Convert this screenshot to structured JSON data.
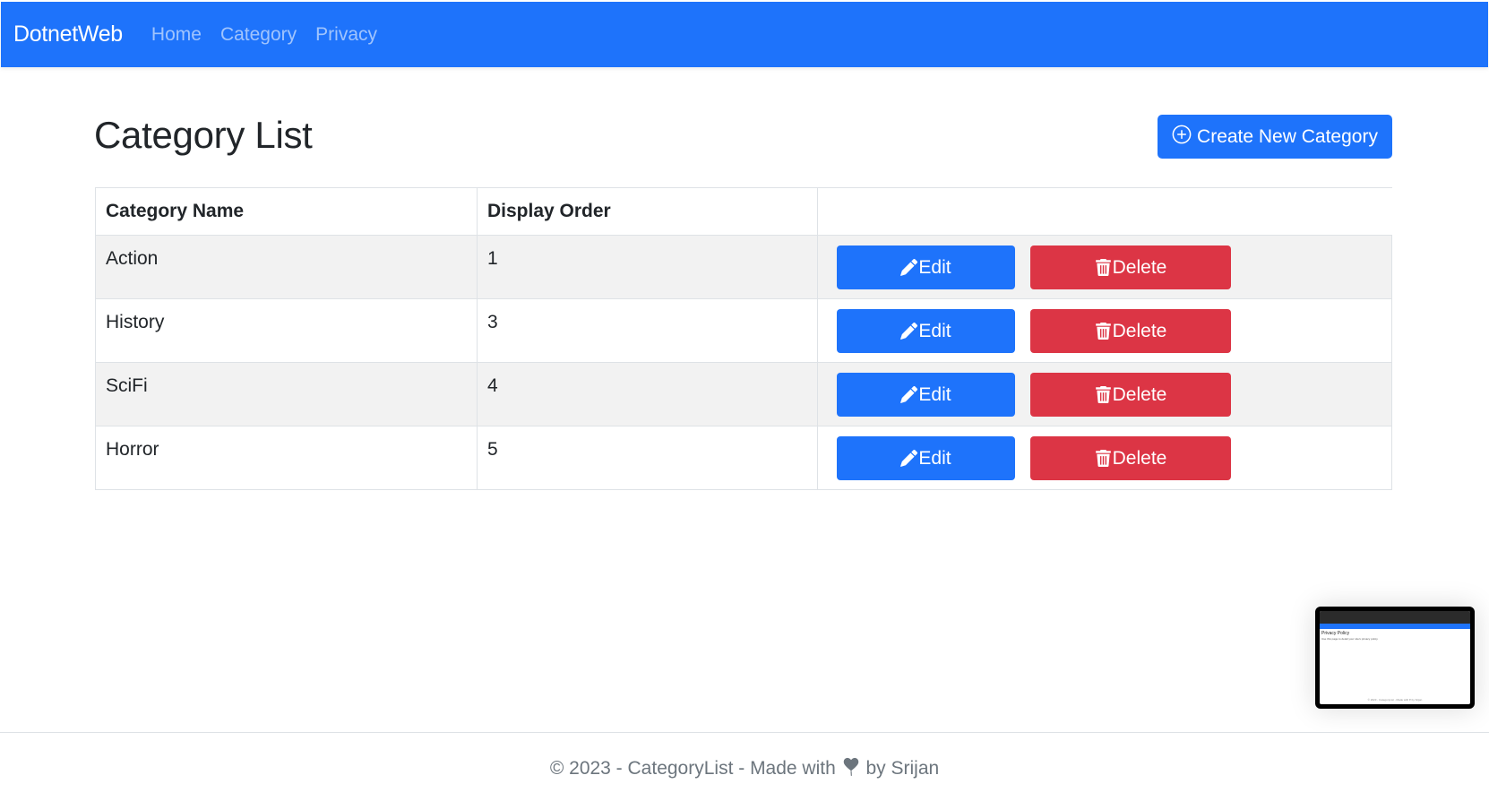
{
  "navbar": {
    "brand": "DotnetWeb",
    "links": [
      {
        "label": "Home"
      },
      {
        "label": "Category"
      },
      {
        "label": "Privacy"
      }
    ],
    "color": "#1e73fb"
  },
  "main": {
    "title": "Category List",
    "create_button": {
      "label": "Create New Category",
      "icon": "plus-circle-icon"
    }
  },
  "table": {
    "columns": [
      "Category Name",
      "Display Order",
      ""
    ],
    "rows": [
      {
        "name": "Action",
        "display_order": "1",
        "edit_label": "Edit",
        "delete_label": "Delete"
      },
      {
        "name": "History",
        "display_order": "3",
        "edit_label": "Edit",
        "delete_label": "Delete"
      },
      {
        "name": "SciFi",
        "display_order": "4",
        "edit_label": "Edit",
        "delete_label": "Delete"
      },
      {
        "name": "Horror",
        "display_order": "5",
        "edit_label": "Edit",
        "delete_label": "Delete"
      }
    ],
    "edit_icon": "pencil-icon",
    "delete_icon": "trash-icon",
    "colors": {
      "edit": "#1e73fb",
      "delete": "#dc3545",
      "stripe": "#f2f2f2"
    }
  },
  "preview": {
    "title": "Privacy Policy",
    "text": "Use this page to detail your site's privacy policy.",
    "footer": "© 2023 - CategoryList - Made with ♥ by Srijan"
  },
  "footer": {
    "prefix": "© 2023 - CategoryList - Made with",
    "suffix": "by Srijan",
    "icon": "heart-icon"
  }
}
